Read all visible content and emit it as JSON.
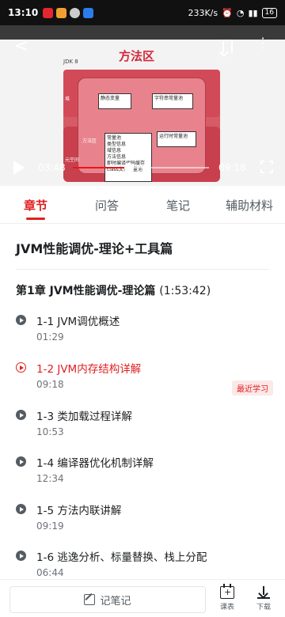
{
  "status_bar": {
    "time": "13:10",
    "network_speed": "233K/s",
    "battery": "16"
  },
  "video": {
    "slide": {
      "title": "方法区",
      "jdk_label": "JDK 8",
      "heap_label": "堆",
      "boxes": [
        "静态变量",
        "字符串常量池",
        "常量池",
        "运行时常量池",
        "方法区",
        "元空间"
      ],
      "list_items": [
        "类型信息",
        "域信息",
        "方法信息",
        "即时编译代码缓存",
        "class文件常量池"
      ]
    },
    "current_time": "03:48",
    "duration": "09:18",
    "progress": 0.41,
    "accent_color": "#f01414"
  },
  "tabs": [
    {
      "label": "章节",
      "active": true
    },
    {
      "label": "问答",
      "active": false
    },
    {
      "label": "笔记",
      "active": false
    },
    {
      "label": "辅助材料",
      "active": false
    }
  ],
  "course": {
    "title": "JVM性能调优-理论+工具篇",
    "chapter": {
      "title": "第1章 JVM性能调优-理论篇",
      "duration": "(1:53:42)"
    },
    "lessons": [
      {
        "title": "1-1 JVM调优概述",
        "duration": "01:29",
        "active": false
      },
      {
        "title": "1-2 JVM内存结构详解",
        "duration": "09:18",
        "active": true,
        "badge": "最近学习"
      },
      {
        "title": "1-3 类加载过程详解",
        "duration": "10:53",
        "active": false
      },
      {
        "title": "1-4 编译器优化机制详解",
        "duration": "12:34",
        "active": false
      },
      {
        "title": "1-5 方法内联讲解",
        "duration": "09:19",
        "active": false
      },
      {
        "title": "1-6 逃逸分析、标量替换、栈上分配",
        "duration": "06:44",
        "active": false
      }
    ]
  },
  "bottom_bar": {
    "note_label": "记笔记",
    "schedule_label": "课表",
    "download_label": "下载"
  }
}
